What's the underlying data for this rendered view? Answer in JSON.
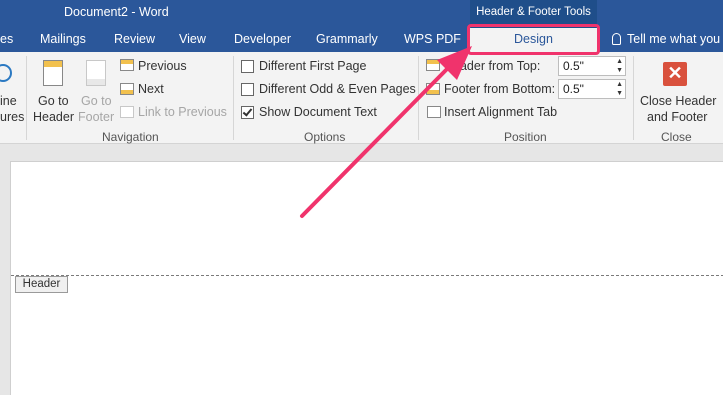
{
  "title_bar": {
    "document_title": "Document2 - Word",
    "context_group": "Header & Footer Tools"
  },
  "tabs": [
    {
      "label": "es"
    },
    {
      "label": "Mailings"
    },
    {
      "label": "Review"
    },
    {
      "label": "View"
    },
    {
      "label": "Developer"
    },
    {
      "label": "Grammarly"
    },
    {
      "label": "WPS PDF"
    },
    {
      "label": "Design",
      "selected": true
    }
  ],
  "tell_me": "Tell me what you",
  "ribbon": {
    "partial_labels": [
      "ine",
      "ures"
    ],
    "navigation": {
      "go_to_header": [
        "Go to",
        "Header"
      ],
      "go_to_footer": [
        "Go to",
        "Footer"
      ],
      "previous": "Previous",
      "next": "Next",
      "link_to_previous": "Link to Previous",
      "group_label": "Navigation"
    },
    "options": {
      "different_first_page": {
        "label": "Different First Page",
        "checked": false
      },
      "different_odd_even": {
        "label": "Different Odd & Even Pages",
        "checked": false
      },
      "show_document_text": {
        "label": "Show Document Text",
        "checked": true
      },
      "group_label": "Options"
    },
    "position": {
      "header_from_top": {
        "label": "Header from Top:",
        "value": "0.5\""
      },
      "footer_from_bottom": {
        "label": "Footer from Bottom:",
        "value": "0.5\""
      },
      "insert_alignment_tab": "Insert Alignment Tab",
      "group_label": "Position"
    },
    "close": {
      "button": [
        "Close Header",
        "and Footer"
      ],
      "group_label": "Close"
    }
  },
  "document": {
    "header_tag": "Header"
  },
  "colors": {
    "brand": "#2b579a",
    "annotation": "#f0336c",
    "close_icon": "#d9513d"
  }
}
